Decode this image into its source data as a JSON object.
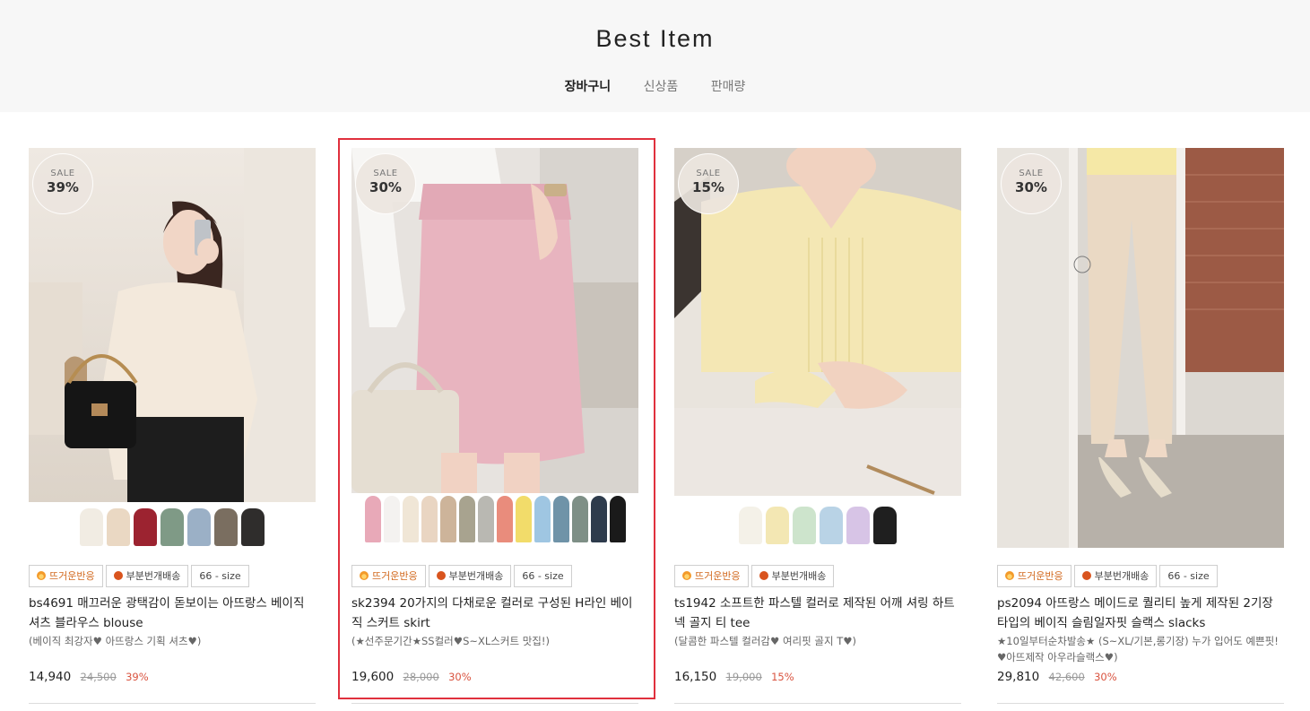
{
  "section": {
    "title": "Best Item",
    "tabs": [
      {
        "label": "장바구니",
        "active": true
      },
      {
        "label": "신상품",
        "active": false
      },
      {
        "label": "판매량",
        "active": false
      }
    ]
  },
  "products": [
    {
      "sale_label": "SALE",
      "sale_percent": "39%",
      "tags": [
        "뜨거운반응",
        "부분번개배송",
        "66 - size"
      ],
      "name": "bs4691 매끄러운 광택감이 돋보이는 아뜨랑스 베이직 셔츠 블라우스 blouse",
      "description": "(베이직 최강자♥ 아뜨랑스 기획 셔츠♥)",
      "price": "14,940",
      "original_price": "24,500",
      "discount": "39%",
      "swatches": [
        "#f1ece3",
        "#ead8c3",
        "#9c2330",
        "#7f9a86",
        "#9bb0c6",
        "#7a6e60",
        "#2f2d2c"
      ]
    },
    {
      "sale_label": "SALE",
      "sale_percent": "30%",
      "tags": [
        "뜨거운반응",
        "부분번개배송",
        "66 - size"
      ],
      "name": "sk2394 20가지의 다채로운 컬러로 구성된 H라인 베이직 스커트 skirt",
      "description": "(★선주문기간★SS컬러♥S~XL스커트 맛집!)",
      "price": "19,600",
      "original_price": "28,000",
      "discount": "30%",
      "selected": true,
      "swatches": [
        "#e8a9b8",
        "#f4f2f0",
        "#f0e6d6",
        "#e9d5c2",
        "#cdb49a",
        "#a8a38f",
        "#b9b8b2",
        "#e98c7c",
        "#f2dc6a",
        "#9fc6e2",
        "#6f93a8",
        "#7e8f86",
        "#2e3b4c",
        "#1a1a1a"
      ]
    },
    {
      "sale_label": "SALE",
      "sale_percent": "15%",
      "tags": [
        "뜨거운반응",
        "부분번개배송"
      ],
      "name": "ts1942 소프트한 파스텔 컬러로 제작된 어깨 셔링 하트넥 골지 티 tee",
      "description": "(달콤한 파스텔 컬러감♥ 여리핏 골지 T♥)",
      "price": "16,150",
      "original_price": "19,000",
      "discount": "15%",
      "swatches": [
        "#f4f1e8",
        "#f3e7b3",
        "#cde4cc",
        "#b9d3e6",
        "#d7c4e6",
        "#1f1f1f"
      ]
    },
    {
      "sale_label": "SALE",
      "sale_percent": "30%",
      "tags": [
        "뜨거운반응",
        "부분번개배송",
        "66 - size"
      ],
      "name": "ps2094 아뜨랑스 메이드로 퀄리티 높게 제작된 2기장 타입의 베이직 슬림일자핏 슬랙스 slacks",
      "description": "★10일부터순차발송★ (S~XL/기본,롱기장) 누가 입어도 예쁜핏! ♥아뜨제작 아우라슬랙스♥)",
      "price": "29,810",
      "original_price": "42,600",
      "discount": "30%",
      "swatches": []
    }
  ],
  "colors": {
    "accent_red": "#e0303d",
    "discount_red": "#d9533f",
    "hot_tag_orange": "#d2691e",
    "header_bg": "#f7f7f7"
  }
}
